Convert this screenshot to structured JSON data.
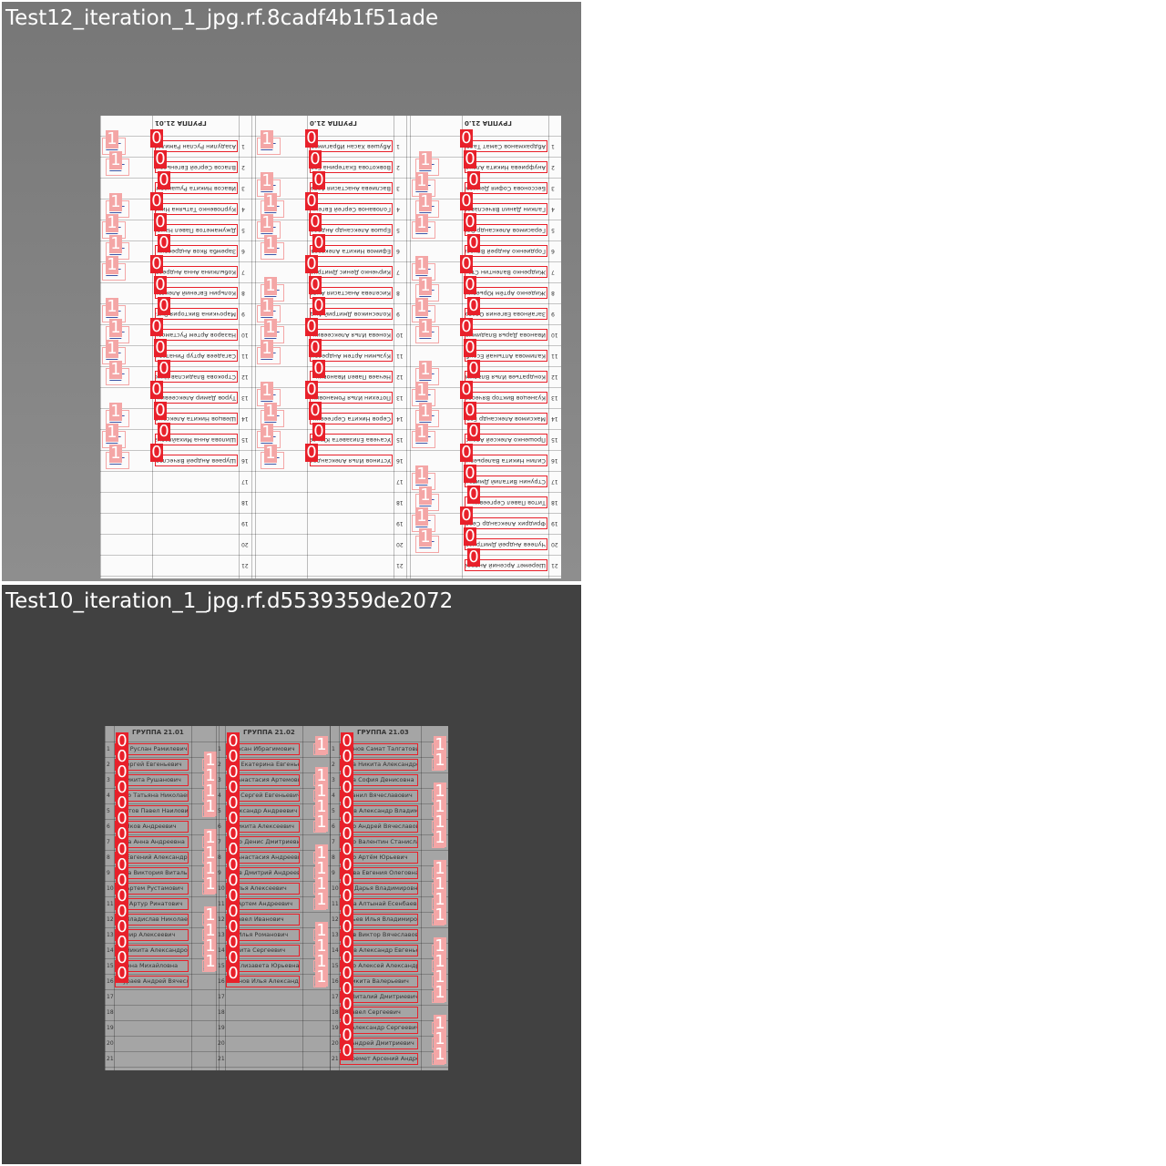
{
  "panels": [
    {
      "title": "Test12_iteration_1_jpg.rf.8cadf4b1f51ade",
      "orientation": "flipped",
      "sheet": "light",
      "groups": [
        "ГРУППА 21.0",
        "ГРУППА 21.0",
        "ГРУППА 21.01"
      ],
      "group_counts": [
        21,
        21,
        21
      ],
      "group_names": [
        [
          "Абдрахманов Самат Талгатович",
          "Ануфриева Никита Алексеевич",
          "Бессонова София Денисовна",
          "Галкин Данил Вячеславович",
          "Герасимов Александр Владимирович",
          "Гордиенко Андрей Вячеславович",
          "Жидренко Валентин Станиславович",
          "Жиденко Артём Юрьевич",
          "Загайнова Евгения Олеговна",
          "Иванова Дарья Владимировна",
          "Калимова Алтынай Есенбаевна",
          "Кондратьев Илья Владимирович",
          "Кузнецов Виктор Вячеславович",
          "Максимов Александр Евгеньевич",
          "Прошенко Алексей Александрович",
          "Силин Никита Валерьевич",
          "Струнин Виталий Дмитриевич",
          "Титов Павел Сергеевич",
          "Фридрих Александр Сергеевич",
          "Чупеев Андрей Дмитриевич",
          "Шеремет Арсений Андреевич"
        ],
        [
          "Абушев Хасан Ибрагимович",
          "Вовкотова Екатерина Евгеньевна",
          "Васлиева Анастасия Артемовна",
          "Голованов Сергей Евгеньевич",
          "Ершов Александр Андреевич",
          "Ефимов Никита Алексеевич",
          "Кирченко Денис Дмитриевич",
          "Киселева Анастасия Андреевна",
          "Колесников Дмитрий Андреевич",
          "Конева Илья Алексеевич",
          "Кузьмин Артем Андреевич",
          "Нечаев Павел Иванович",
          "Потехин Илья Романович",
          "Серов Никита Сергеевич",
          "Усачева Елизавета Юрьевна",
          "Устинов Илья Александрович"
        ],
        [
          "Азадулин Руслан Рамилевич",
          "Власов Сергей Евгеньевич",
          "Ивасов Никита Рушанович",
          "Курповенко Татьяна Николаевна",
          "Джумаметов Павел Наилович",
          "Заремба Яков Андреевич",
          "Кобылкина Анна Андреевна",
          "Кольрин Евгений Александрович",
          "Марочкина Виктория Витальевна",
          "Назаров Артем Рустамович",
          "Сагадеев Артур Ринатович",
          "Строкова Владислав Николаевич",
          "Туров Дамир Алексеевич",
          "Шевцов Никита Александрович",
          "Шилова Анна Михайловна",
          "Шураев Андрей Вячеславович"
        ]
      ]
    },
    {
      "title": "Test10_iteration_1_jpg.rf.d5539359de2072",
      "orientation": "upright",
      "sheet": "gray",
      "groups": [
        "ГРУППА 21.01",
        "ГРУППА 21.02",
        "ГРУППА 21.03"
      ],
      "group_counts": [
        21,
        21,
        21
      ],
      "group_names": [
        [
          "лин Руслан Рамилевич",
          "в Сергей Евгеньевич",
          "в Никита Рушанович",
          "енко Татьяна Николаевна",
          "аметов Павел Наилович",
          "ба Яков Андреевич",
          "кина Анна Андреевна",
          "ин Евгений Александрович",
          "кина Виктория Витальевна",
          "ов Артем Рустамович",
          "еев Артур Ринатович",
          "ов Владислав Николаевич",
          "Дамир Алексеевич",
          "ов Никита Александрович",
          "а Анна Михайловна",
          "Шураев Андрей Вячеславович"
        ],
        [
          "в Хасан Ибрагимович",
          "ина Екатерина Евгеньевна",
          "ва Анастасия Артемовна",
          "нов Сергей Евгеньевич",
          "Александр Андреевич",
          "в Никита Алексеевич",
          "енко Денис Дмитриевич",
          "ва Анастасия Андреевна",
          "иков Дмитрий Андреевич",
          "в Илья Алексеевич",
          "ин Артем Андреевич",
          "в Павел Иванович",
          "ин Илья Романович",
          "Никита Сергеевич",
          "ва Елизавета Юрьевна",
          "ятинов Илья Александрович"
        ],
        [
          "хманов Самат Талгатович",
          "иева Никита Александрович",
          "нова София Денисовна",
          "н Данил Вячеславович",
          "имов Александр Владимирович",
          "енко Андрей Вячеславович",
          "енко Валентин Станиславович",
          "енко Артём Юрьевич",
          "йнова Евгения Олеговна",
          "ова Дарья Владимировна",
          "мова Алтынай Есенбаевна",
          "ратьев Илья Владимирович",
          "ецов Виктор Вячеславович",
          "имов Александр Евгеньевич",
          "енко Алексей Александрович",
          "н Никита Валерьевич",
          "ин Виталий Дмитриевич",
          "в Павел Сергеевич",
          "их Александр Сергеевич",
          "ев Андрей Дмитриевич",
          "Шеремет Арсений Андреевич"
        ]
      ]
    }
  ],
  "class_labels": {
    "name": "0",
    "signature": "1"
  },
  "colors": {
    "class_0": "#e8202a",
    "class_1": "#f4a6a6",
    "signature_ink": "#3d55a5"
  }
}
